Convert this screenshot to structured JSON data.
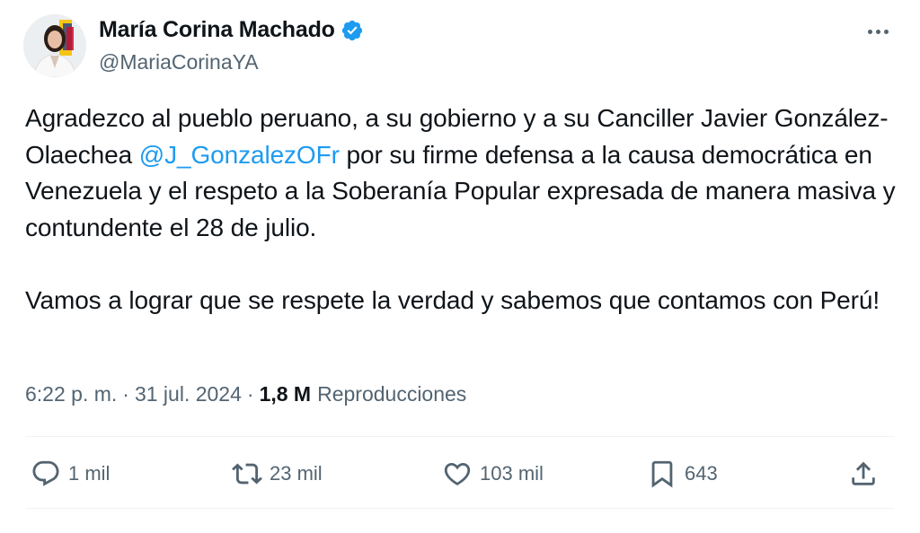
{
  "author": {
    "display_name": "María Corina Machado",
    "handle": "@MariaCorinaYA",
    "verified": true,
    "verified_color": "#1d9bf0"
  },
  "tweet": {
    "paragraph1": {
      "before": "Agradezco al pueblo peruano, a su gobierno y a su Canciller Javier González-Olaechea ",
      "mention": "@J_GonzalezOFr",
      "after": " por su firme defensa a la causa democrática en Venezuela y el respeto a la Soberanía Popular expresada de manera masiva y contundente el 28 de julio."
    },
    "paragraph2": "Vamos a lograr que se respete la verdad y sabemos que contamos con Perú!",
    "mention_color": "#1d9bf0"
  },
  "meta": {
    "time": "6:22 p. m.",
    "separator": "·",
    "date": "31 jul. 2024",
    "views_count": "1,8 M",
    "views_label": "Reproducciones"
  },
  "actions": {
    "reply": {
      "icon": "reply-icon",
      "count": "1 mil"
    },
    "retweet": {
      "icon": "retweet-icon",
      "count": "23 mil"
    },
    "like": {
      "icon": "heart-icon",
      "count": "103 mil"
    },
    "bookmark": {
      "icon": "bookmark-icon",
      "count": "643"
    },
    "share": {
      "icon": "share-icon"
    }
  },
  "colors": {
    "text_primary": "#0f1419",
    "text_secondary": "#536471",
    "divider": "#eff3f4"
  }
}
